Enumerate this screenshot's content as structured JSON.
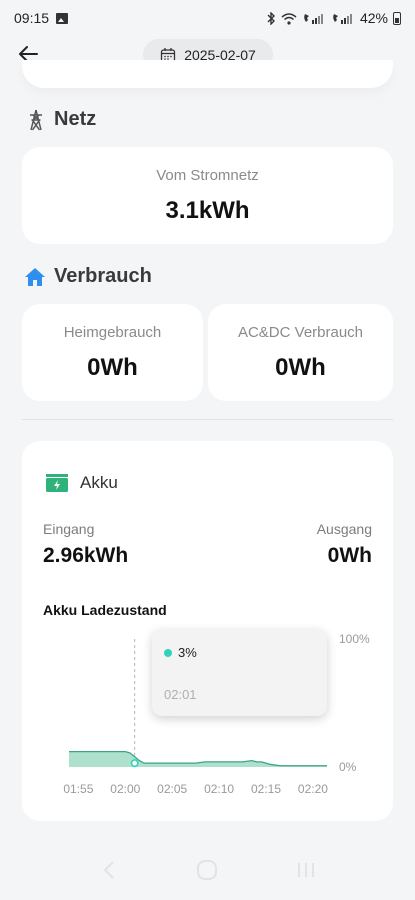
{
  "status_bar": {
    "time": "09:15",
    "battery": "42%",
    "icons": [
      "gallery-icon",
      "bluetooth-icon",
      "wifi-icon",
      "volte-icon",
      "signal-icon",
      "battery-icon"
    ]
  },
  "header": {
    "date": "2025-02-07"
  },
  "netz": {
    "title": "Netz",
    "grid_label": "Vom Stromnetz",
    "grid_value": "3.1kWh"
  },
  "verbrauch": {
    "title": "Verbrauch",
    "home_label": "Heimgebrauch",
    "home_value": "0Wh",
    "acdc_label": "AC&DC Verbrauch",
    "acdc_value": "0Wh"
  },
  "akku": {
    "title": "Akku",
    "input_label": "Eingang",
    "input_value": "2.96kWh",
    "output_label": "Ausgang",
    "output_value": "0Wh",
    "chart_title": "Akku Ladezustand",
    "tooltip_value": "3%",
    "tooltip_time": "02:01"
  },
  "colors": {
    "accent": "#2fd4b8",
    "area_fill": "#9fdcc6",
    "line": "#3aa585",
    "icon_blue": "#2f8ff0"
  },
  "chart_data": {
    "type": "area",
    "title": "Akku Ladezustand",
    "y_tick_labels": [
      "100%",
      "0%"
    ],
    "ylim": [
      0,
      100
    ],
    "x_tick_labels": [
      "01:55",
      "02:00",
      "02:05",
      "02:10",
      "02:15",
      "02:20"
    ],
    "xlim_minutes": [
      -6.5,
      21
    ],
    "series": [
      {
        "x_minutes_after_0155": [
          -6.5,
          -1,
          -0.5,
          0,
          0.5,
          1,
          1.5,
          2,
          2.5,
          3,
          3.5,
          4,
          5,
          6,
          7,
          8,
          9,
          10,
          11,
          12,
          13,
          13.5,
          14,
          15,
          16,
          17,
          18,
          19,
          20,
          21
        ],
        "y": [
          12,
          12,
          12,
          11,
          8,
          5,
          3,
          3,
          3,
          3,
          3,
          3,
          3,
          3,
          3,
          4,
          4,
          4,
          4,
          4,
          5,
          4,
          4,
          2,
          1,
          1,
          1,
          1,
          1,
          1
        ]
      }
    ],
    "cursor": {
      "x_label": "02:01",
      "value": "3%"
    },
    "grid": false,
    "legend": "none"
  }
}
